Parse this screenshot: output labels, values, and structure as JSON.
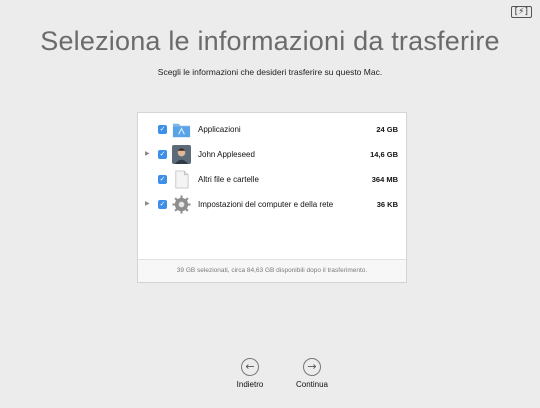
{
  "status": {
    "battery_glyph": "[⚡]"
  },
  "header": {
    "title": "Seleziona le informazioni da trasferire",
    "subtitle": "Scegli le informazioni che desideri trasferire su questo Mac."
  },
  "items": [
    {
      "label": "Applicazioni",
      "size": "24 GB",
      "icon": "applications-folder-icon",
      "expandable": false,
      "checked": true
    },
    {
      "label": "John Appleseed",
      "size": "14,6 GB",
      "icon": "user-avatar-icon",
      "expandable": true,
      "checked": true
    },
    {
      "label": "Altri file e cartelle",
      "size": "364 MB",
      "icon": "document-icon",
      "expandable": false,
      "checked": true
    },
    {
      "label": "Impostazioni del computer e della rete",
      "size": "36 KB",
      "icon": "gear-icon",
      "expandable": true,
      "checked": true
    }
  ],
  "footer": {
    "text": "39 GB selezionati, circa 84,63 GB disponibili dopo il trasferimento."
  },
  "nav": {
    "back_label": "Indietro",
    "continue_label": "Continua",
    "back_glyph": "←",
    "continue_glyph": "→"
  },
  "colors": {
    "checkbox": "#3d8fe8",
    "title": "#6b6b6b"
  }
}
